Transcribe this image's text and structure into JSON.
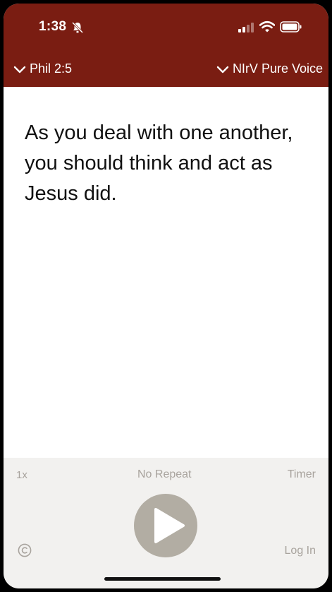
{
  "status_bar": {
    "time": "1:38",
    "icons": [
      "bell-off-icon",
      "signal-icon",
      "wifi-icon",
      "battery-icon"
    ]
  },
  "header": {
    "reference": "Phil 2:5",
    "version": "NIrV Pure Voice",
    "icon": "chevron-down-icon",
    "background_color": "#7a1d12"
  },
  "verse": {
    "text": "As you deal with one another, you should think and act as Jesus did."
  },
  "controls": {
    "speed_label": "1x",
    "repeat_label": "No Repeat",
    "timer_label": "Timer",
    "login_label": "Log In",
    "play_icon": "play-icon",
    "copyright_icon": "copyright-icon"
  }
}
